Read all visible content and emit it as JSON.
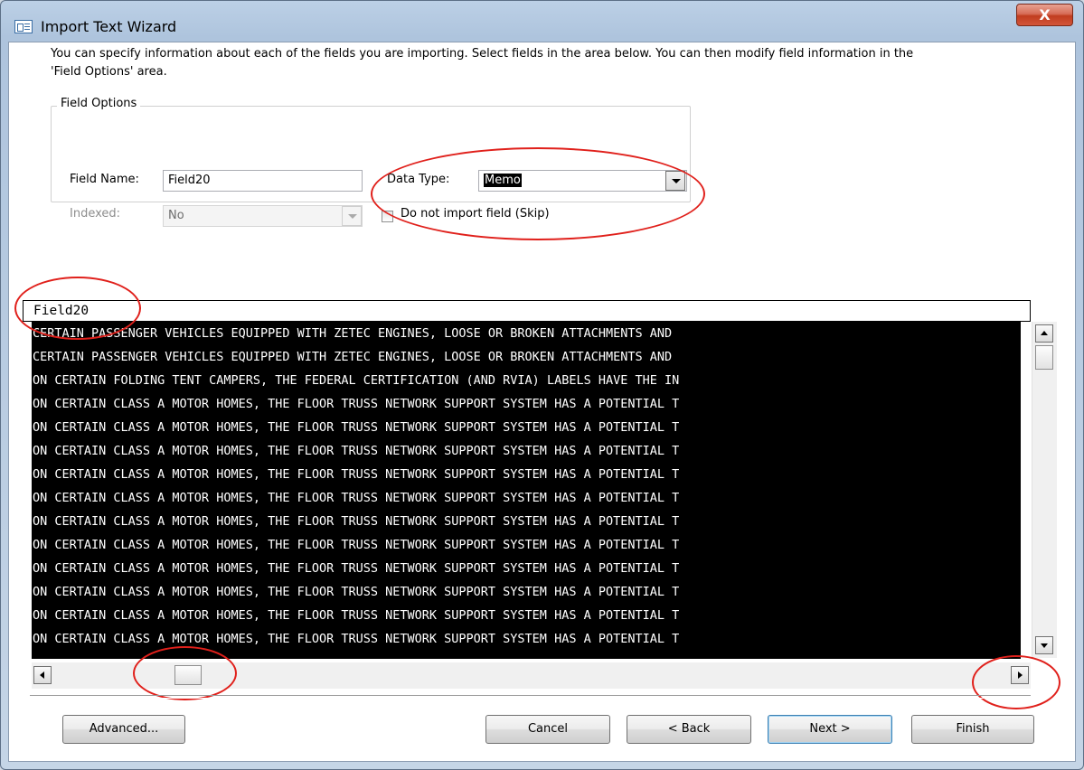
{
  "window": {
    "title": "Import Text Wizard",
    "close_glyph": "X"
  },
  "instructions": "You can specify information about each of the fields you are importing. Select fields in the area below. You can then modify field information in the 'Field Options' area.",
  "field_options": {
    "legend": "Field Options",
    "field_name_label": "Field Name:",
    "field_name_value": "Field20",
    "data_type_label": "Data Type:",
    "data_type_value": "Memo",
    "indexed_label": "Indexed:",
    "indexed_value": "No",
    "skip_label": "Do not import field (Skip)",
    "skip_checked": false
  },
  "preview": {
    "header": "Field20",
    "rows": [
      "CERTAIN PASSENGER VEHICLES EQUIPPED WITH ZETEC ENGINES, LOOSE OR BROKEN ATTACHMENTS AND",
      "CERTAIN PASSENGER VEHICLES EQUIPPED WITH ZETEC ENGINES, LOOSE OR BROKEN ATTACHMENTS AND",
      "ON CERTAIN FOLDING TENT CAMPERS, THE FEDERAL CERTIFICATION (AND RVIA) LABELS HAVE THE IN",
      "ON CERTAIN CLASS A MOTOR HOMES, THE FLOOR TRUSS NETWORK SUPPORT SYSTEM HAS A POTENTIAL T",
      "ON CERTAIN CLASS A MOTOR HOMES, THE FLOOR TRUSS NETWORK SUPPORT SYSTEM HAS A POTENTIAL T",
      "ON CERTAIN CLASS A MOTOR HOMES, THE FLOOR TRUSS NETWORK SUPPORT SYSTEM HAS A POTENTIAL T",
      "ON CERTAIN CLASS A MOTOR HOMES, THE FLOOR TRUSS NETWORK SUPPORT SYSTEM HAS A POTENTIAL T",
      "ON CERTAIN CLASS A MOTOR HOMES, THE FLOOR TRUSS NETWORK SUPPORT SYSTEM HAS A POTENTIAL T",
      "ON CERTAIN CLASS A MOTOR HOMES, THE FLOOR TRUSS NETWORK SUPPORT SYSTEM HAS A POTENTIAL T",
      "ON CERTAIN CLASS A MOTOR HOMES, THE FLOOR TRUSS NETWORK SUPPORT SYSTEM HAS A POTENTIAL T",
      "ON CERTAIN CLASS A MOTOR HOMES, THE FLOOR TRUSS NETWORK SUPPORT SYSTEM HAS A POTENTIAL T",
      "ON CERTAIN CLASS A MOTOR HOMES, THE FLOOR TRUSS NETWORK SUPPORT SYSTEM HAS A POTENTIAL T",
      "ON CERTAIN CLASS A MOTOR HOMES, THE FLOOR TRUSS NETWORK SUPPORT SYSTEM HAS A POTENTIAL T",
      "ON CERTAIN CLASS A MOTOR HOMES, THE FLOOR TRUSS NETWORK SUPPORT SYSTEM HAS A POTENTIAL T"
    ]
  },
  "buttons": {
    "advanced": "Advanced...",
    "cancel": "Cancel",
    "back": "< Back",
    "next": "Next >",
    "finish": "Finish"
  },
  "icons": {
    "app": "import-text-wizard-icon",
    "close": "close-icon",
    "dropdown": "chevron-down-icon",
    "scroll_up": "scroll-up-arrow-icon",
    "scroll_down": "scroll-down-arrow-icon",
    "scroll_left": "scroll-left-arrow-icon",
    "scroll_right": "scroll-right-arrow-icon"
  },
  "colors": {
    "annotation_red": "#e0201b",
    "preview_background": "#000000",
    "preview_text": "#ffffff",
    "close_button_red": "#c13d1f"
  }
}
